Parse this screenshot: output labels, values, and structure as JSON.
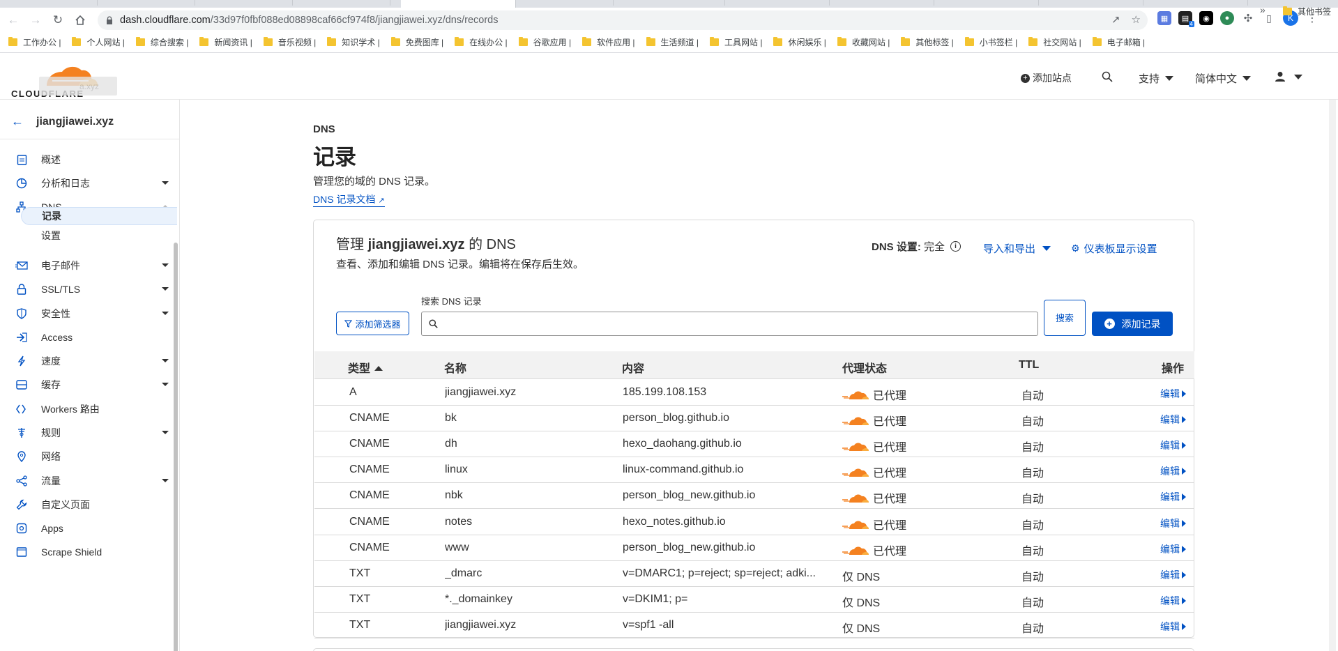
{
  "browser": {
    "url_host": "dash.cloudflare.com",
    "url_path": "/33d97f0fbf088ed08898caf66cf974f8/jiangjiawei.xyz/dns/records",
    "profile_initial": "K",
    "ext_badge": "4"
  },
  "bookmarks": {
    "items": [
      "工作办公 |",
      "个人网站 |",
      "综合搜索 |",
      "新闻资讯 |",
      "音乐视频 |",
      "知识学术 |",
      "免费图库 |",
      "在线办公 |",
      "谷歌应用 |",
      "软件应用 |",
      "生活频道 |",
      "工具网站 |",
      "休闲娱乐 |",
      "收藏网站 |",
      "其他标签 |",
      "小书签栏 |",
      "社交网站 |",
      "电子邮箱 |"
    ],
    "more": "»",
    "other": "其他书签"
  },
  "header": {
    "logo_text": "CLOUDFLARE",
    "tooltip_ghost": "a.xyz",
    "add_site": "添加站点",
    "support": "支持",
    "language": "简体中文"
  },
  "sidebar": {
    "domain": "jiangjiawei.xyz",
    "items": [
      {
        "label": "概述",
        "icon": "clipboard-icon"
      },
      {
        "label": "分析和日志",
        "icon": "chart-pie-icon"
      },
      {
        "label": "DNS",
        "icon": "network-icon"
      },
      {
        "label": "电子邮件",
        "icon": "email-icon"
      },
      {
        "label": "SSL/TLS",
        "icon": "lock-icon"
      },
      {
        "label": "安全性",
        "icon": "shield-icon"
      },
      {
        "label": "Access",
        "icon": "access-icon"
      },
      {
        "label": "速度",
        "icon": "bolt-icon"
      },
      {
        "label": "缓存",
        "icon": "storage-icon"
      },
      {
        "label": "Workers 路由",
        "icon": "workers-icon"
      },
      {
        "label": "规则",
        "icon": "rules-icon"
      },
      {
        "label": "网络",
        "icon": "location-icon"
      },
      {
        "label": "流量",
        "icon": "traffic-icon"
      },
      {
        "label": "自定义页面",
        "icon": "wrench-icon"
      },
      {
        "label": "Apps",
        "icon": "apps-icon"
      },
      {
        "label": "Scrape Shield",
        "icon": "scrape-shield-icon"
      }
    ],
    "dns_sub": [
      "记录",
      "设置"
    ]
  },
  "main": {
    "crumb": "DNS",
    "title": "记录",
    "desc": "管理您的域的 DNS 记录。",
    "doc_link": "DNS 记录文档"
  },
  "card": {
    "title_prefix": "管理 ",
    "title_domain": "jiangjiawei.xyz",
    "title_suffix": " 的 DNS",
    "subtitle": "查看、添加和编辑 DNS 记录。编辑将在保存后生效。",
    "dns_setting_label": "DNS 设置:",
    "dns_setting_value": "完全",
    "import_export": "导入和导出",
    "dashboard_settings": "仪表板显示设置",
    "filter_btn": "添加筛选器",
    "search_label": "搜索 DNS 记录",
    "search_btn": "搜索",
    "add_record": "添加记录"
  },
  "table": {
    "headers": {
      "type": "类型",
      "name": "名称",
      "content": "内容",
      "proxy": "代理状态",
      "ttl": "TTL",
      "action": "操作"
    },
    "rows": [
      {
        "type": "A",
        "name": "jiangjiawei.xyz",
        "content": "185.199.108.153",
        "proxy": "已代理",
        "proxied": true,
        "ttl": "自动",
        "edit": "编辑"
      },
      {
        "type": "CNAME",
        "name": "bk",
        "content": "person_blog.github.io",
        "proxy": "已代理",
        "proxied": true,
        "ttl": "自动",
        "edit": "编辑"
      },
      {
        "type": "CNAME",
        "name": "dh",
        "content": "hexo_daohang.github.io",
        "proxy": "已代理",
        "proxied": true,
        "ttl": "自动",
        "edit": "编辑"
      },
      {
        "type": "CNAME",
        "name": "linux",
        "content": "linux-command.github.io",
        "proxy": "已代理",
        "proxied": true,
        "ttl": "自动",
        "edit": "编辑"
      },
      {
        "type": "CNAME",
        "name": "nbk",
        "content": "person_blog_new.github.io",
        "proxy": "已代理",
        "proxied": true,
        "ttl": "自动",
        "edit": "编辑"
      },
      {
        "type": "CNAME",
        "name": "notes",
        "content": "hexo_notes.github.io",
        "proxy": "已代理",
        "proxied": true,
        "ttl": "自动",
        "edit": "编辑"
      },
      {
        "type": "CNAME",
        "name": "www",
        "content": "person_blog_new.github.io",
        "proxy": "已代理",
        "proxied": true,
        "ttl": "自动",
        "edit": "编辑"
      },
      {
        "type": "TXT",
        "name": "_dmarc",
        "content": "v=DMARC1; p=reject; sp=reject; adki...",
        "proxy": "仅 DNS",
        "proxied": false,
        "ttl": "自动",
        "edit": "编辑"
      },
      {
        "type": "TXT",
        "name": "*._domainkey",
        "content": "v=DKIM1; p=",
        "proxy": "仅 DNS",
        "proxied": false,
        "ttl": "自动",
        "edit": "编辑"
      },
      {
        "type": "TXT",
        "name": "jiangjiawei.xyz",
        "content": "v=spf1 -all",
        "proxy": "仅 DNS",
        "proxied": false,
        "ttl": "自动",
        "edit": "编辑"
      }
    ]
  },
  "colors": {
    "brand_orange": "#f48120",
    "link_blue": "#0051c3"
  }
}
